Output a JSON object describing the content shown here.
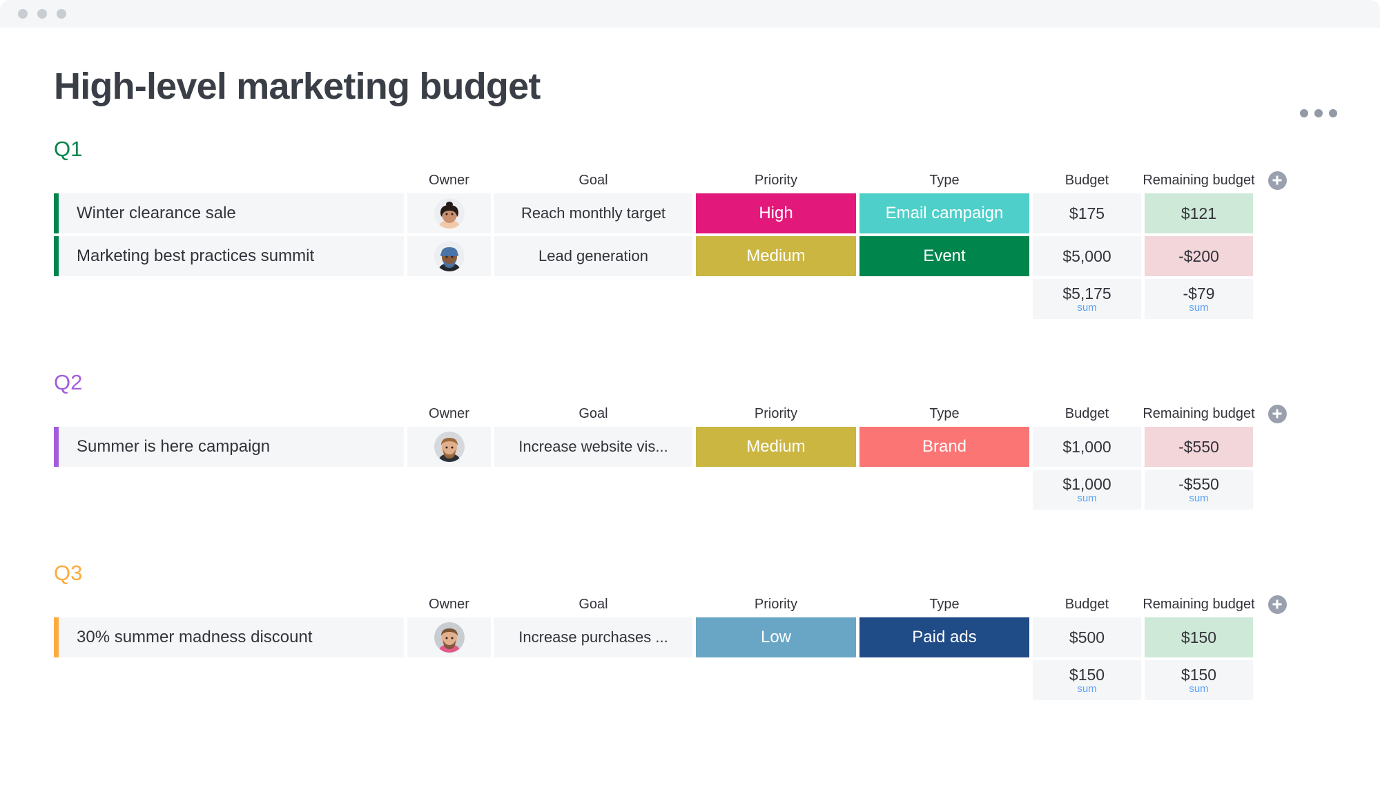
{
  "window": {
    "traffic_lights": [
      "close",
      "minimize",
      "zoom"
    ]
  },
  "header": {
    "title": "High-level marketing budget",
    "more_menu_label": "more-options"
  },
  "columns": {
    "owner": "Owner",
    "goal": "Goal",
    "priority": "Priority",
    "type": "Type",
    "budget": "Budget",
    "remaining": "Remaining budget",
    "add_column": "add-column"
  },
  "colors": {
    "q1_accent": "#00854d",
    "q2_accent": "#a25ddc",
    "q3_accent": "#fdab3d",
    "priority_high": "#e2197a",
    "priority_medium": "#cab641",
    "priority_low": "#69a6c6",
    "type_email": "#4ecfc9",
    "type_event": "#00854d",
    "type_brand": "#fb7575",
    "type_paid_ads": "#1f4b86",
    "remaining_positive_bg": "#cfe9d8",
    "remaining_negative_bg": "#f3d6da",
    "sum_label": "#5ba4f5",
    "cell_bg": "#f5f6f8"
  },
  "groups": [
    {
      "title": "Q1",
      "accent": "#00854d",
      "rows": [
        {
          "name": "Winter clearance sale",
          "owner_avatar": "avatar-woman-dark-hair",
          "goal": "Reach monthly target",
          "priority": "High",
          "priority_color": "#e2197a",
          "type": "Email campaign",
          "type_color": "#4ecfc9",
          "budget": "$175",
          "remaining": "$121",
          "remaining_state": "positive"
        },
        {
          "name": "Marketing best practices summit",
          "owner_avatar": "avatar-man-beard-bandana",
          "goal": "Lead generation",
          "priority": "Medium",
          "priority_color": "#cab641",
          "type": "Event",
          "type_color": "#00854d",
          "budget": "$5,000",
          "remaining": "-$200",
          "remaining_state": "negative"
        }
      ],
      "sums": {
        "budget_value": "$5,175",
        "budget_label": "sum",
        "remaining_value": "-$79",
        "remaining_label": "sum"
      }
    },
    {
      "title": "Q2",
      "accent": "#a25ddc",
      "rows": [
        {
          "name": "Summer is here campaign",
          "owner_avatar": "avatar-man-blond-beard",
          "goal": "Increase website vis...",
          "priority": "Medium",
          "priority_color": "#cab641",
          "type": "Brand",
          "type_color": "#fb7575",
          "budget": "$1,000",
          "remaining": "-$550",
          "remaining_state": "negative"
        }
      ],
      "sums": {
        "budget_value": "$1,000",
        "budget_label": "sum",
        "remaining_value": "-$550",
        "remaining_label": "sum"
      }
    },
    {
      "title": "Q3",
      "accent": "#fdab3d",
      "rows": [
        {
          "name": "30% summer madness discount",
          "owner_avatar": "avatar-man-bald-beard",
          "goal": "Increase purchases ...",
          "priority": "Low",
          "priority_color": "#69a6c6",
          "type": "Paid ads",
          "type_color": "#1f4b86",
          "budget": "$500",
          "remaining": "$150",
          "remaining_state": "positive"
        }
      ],
      "sums": {
        "budget_value": "$150",
        "budget_label": "sum",
        "remaining_value": "$150",
        "remaining_label": "sum"
      }
    }
  ]
}
